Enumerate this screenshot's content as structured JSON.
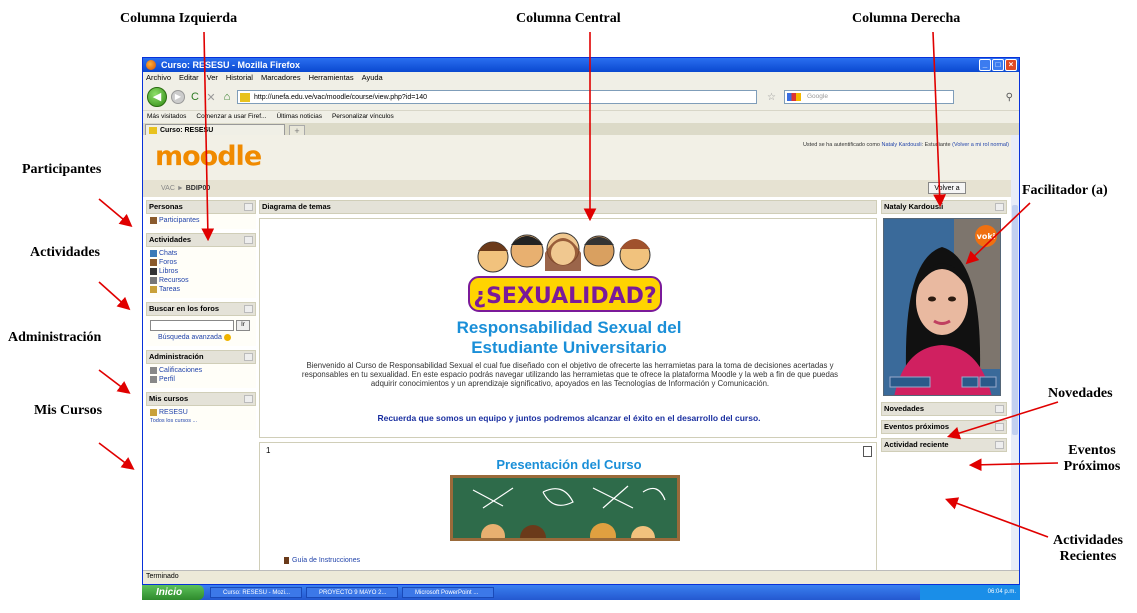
{
  "annotations": {
    "columna_izquierda": "Columna Izquierda",
    "columna_central": "Columna Central",
    "columna_derecha": "Columna Derecha",
    "participantes": "Participantes",
    "actividades": "Actividades",
    "administracion": "Administración",
    "mis_cursos": "Mis Cursos",
    "facilitador": "Facilitador (a)",
    "novedades": "Novedades",
    "eventos_line1": "Eventos",
    "eventos_line2": "Próximos",
    "actividades_recientes_line1": "Actividades",
    "actividades_recientes_line2": "Recientes"
  },
  "browser": {
    "title": "Curso: RESESU - Mozilla Firefox",
    "menu": [
      "Archivo",
      "Editar",
      "Ver",
      "Historial",
      "Marcadores",
      "Herramientas",
      "Ayuda"
    ],
    "url": "http://unefa.edu.ve/vac/moodle/course/view.php?id=140",
    "search_placeholder": "Google",
    "bookmarks": [
      "Más visitados",
      "Comenzar a usar Firef...",
      "Últimas noticias",
      "Personalizar vínculos"
    ],
    "tab_label": "Curso: RESESU",
    "status": "Terminado"
  },
  "moodle": {
    "logo": "moodle",
    "login_prefix": "Usted se ha autentificado como",
    "login_user": "Nataly Kardousli",
    "login_role": ": Estudiante",
    "login_link": "(Volver a mi rol normal)",
    "breadcrumb_1": "VAC",
    "breadcrumb_sep": "►",
    "breadcrumb_2": "BDIP00",
    "volver_button": "Volver a",
    "left": {
      "personas_title": "Personas",
      "participantes_link": "Participantes",
      "actividades_title": "Actividades",
      "actividades_items": [
        "Chats",
        "Foros",
        "Libros",
        "Recursos",
        "Tareas"
      ],
      "buscar_title": "Buscar en los foros",
      "buscar_go": "Ir",
      "busqueda_avanzada": "Búsqueda avanzada",
      "admin_title": "Administración",
      "admin_items": [
        "Calificaciones",
        "Perfil"
      ],
      "miscursos_title": "Mis cursos",
      "miscursos_item": "RESESU",
      "todos_cursos": "Todos los cursos ..."
    },
    "center": {
      "header": "Diagrama de temas",
      "cartoon_text": "¿SEXUALIDAD?",
      "title_line1": "Responsabilidad Sexual del",
      "title_line2": "Estudiante Universitario",
      "description": "Bienvenido al Curso de Responsabilidad Sexual el cual fue diseñado con el objetivo de ofrecerte las herramietas para la toma de decisiones acertadas y responsables en tu sexualidad. En este espacio podrás navegar utilizando las herramietas que te ofrece la plataforma Moodle y la web a fin de que puedas adquirir conocimientos y un aprendizaje significativo, apoyados en las Tecnologías de Información y Comunicación.",
      "motto": "Recuerda que somos un equipo y juntos podremos alcanzar el éxito en el desarrollo del curso.",
      "section_number": "1",
      "section_title": "Presentación del Curso",
      "guia_link": "Guía de Instrucciones"
    },
    "right": {
      "facilitator_name": "Nataly Kardousli",
      "voki_label": "voki",
      "novedades": "Novedades",
      "eventos": "Eventos próximos",
      "actividad_reciente": "Actividad reciente"
    }
  },
  "taskbar": {
    "start": "Inicio",
    "items": [
      "Curso: RESESU - Mozi...",
      "PROYECTO 9 MAYO 2...",
      "Microsoft PowerPoint ..."
    ],
    "clock": "06:04 p.m."
  },
  "colors": {
    "moodle_orange": "#f08a00",
    "title_blue": "#1a8fd8",
    "motto_blue": "#1a2fa0",
    "arrow_red": "#e00000"
  }
}
